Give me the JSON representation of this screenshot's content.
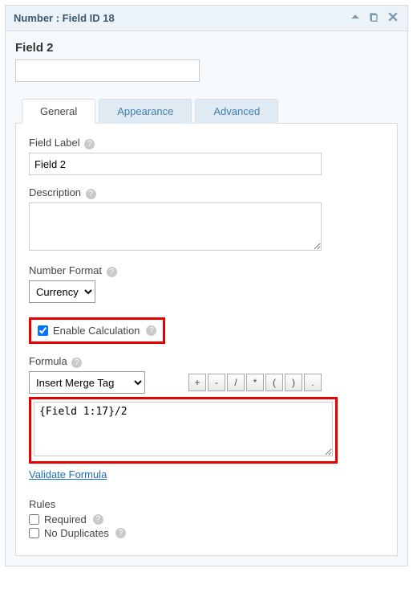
{
  "header": {
    "title": "Number : Field ID 18"
  },
  "field_title": "Field 2",
  "preview_value": "",
  "tabs": {
    "general": "General",
    "appearance": "Appearance",
    "advanced": "Advanced"
  },
  "labels": {
    "field_label": "Field Label",
    "description": "Description",
    "number_format": "Number Format",
    "enable_calculation": "Enable Calculation",
    "formula": "Formula",
    "insert_merge_tag": "Insert Merge Tag",
    "validate_formula": "Validate Formula",
    "rules": "Rules",
    "required": "Required",
    "no_duplicates": "No Duplicates"
  },
  "values": {
    "field_label": "Field 2",
    "description": "",
    "number_format": "Currency",
    "enable_calculation": true,
    "formula": "{Field 1:17}/2",
    "required": false,
    "no_duplicates": false
  },
  "operators": [
    "+",
    "-",
    "/",
    "*",
    "(",
    ")",
    "."
  ]
}
